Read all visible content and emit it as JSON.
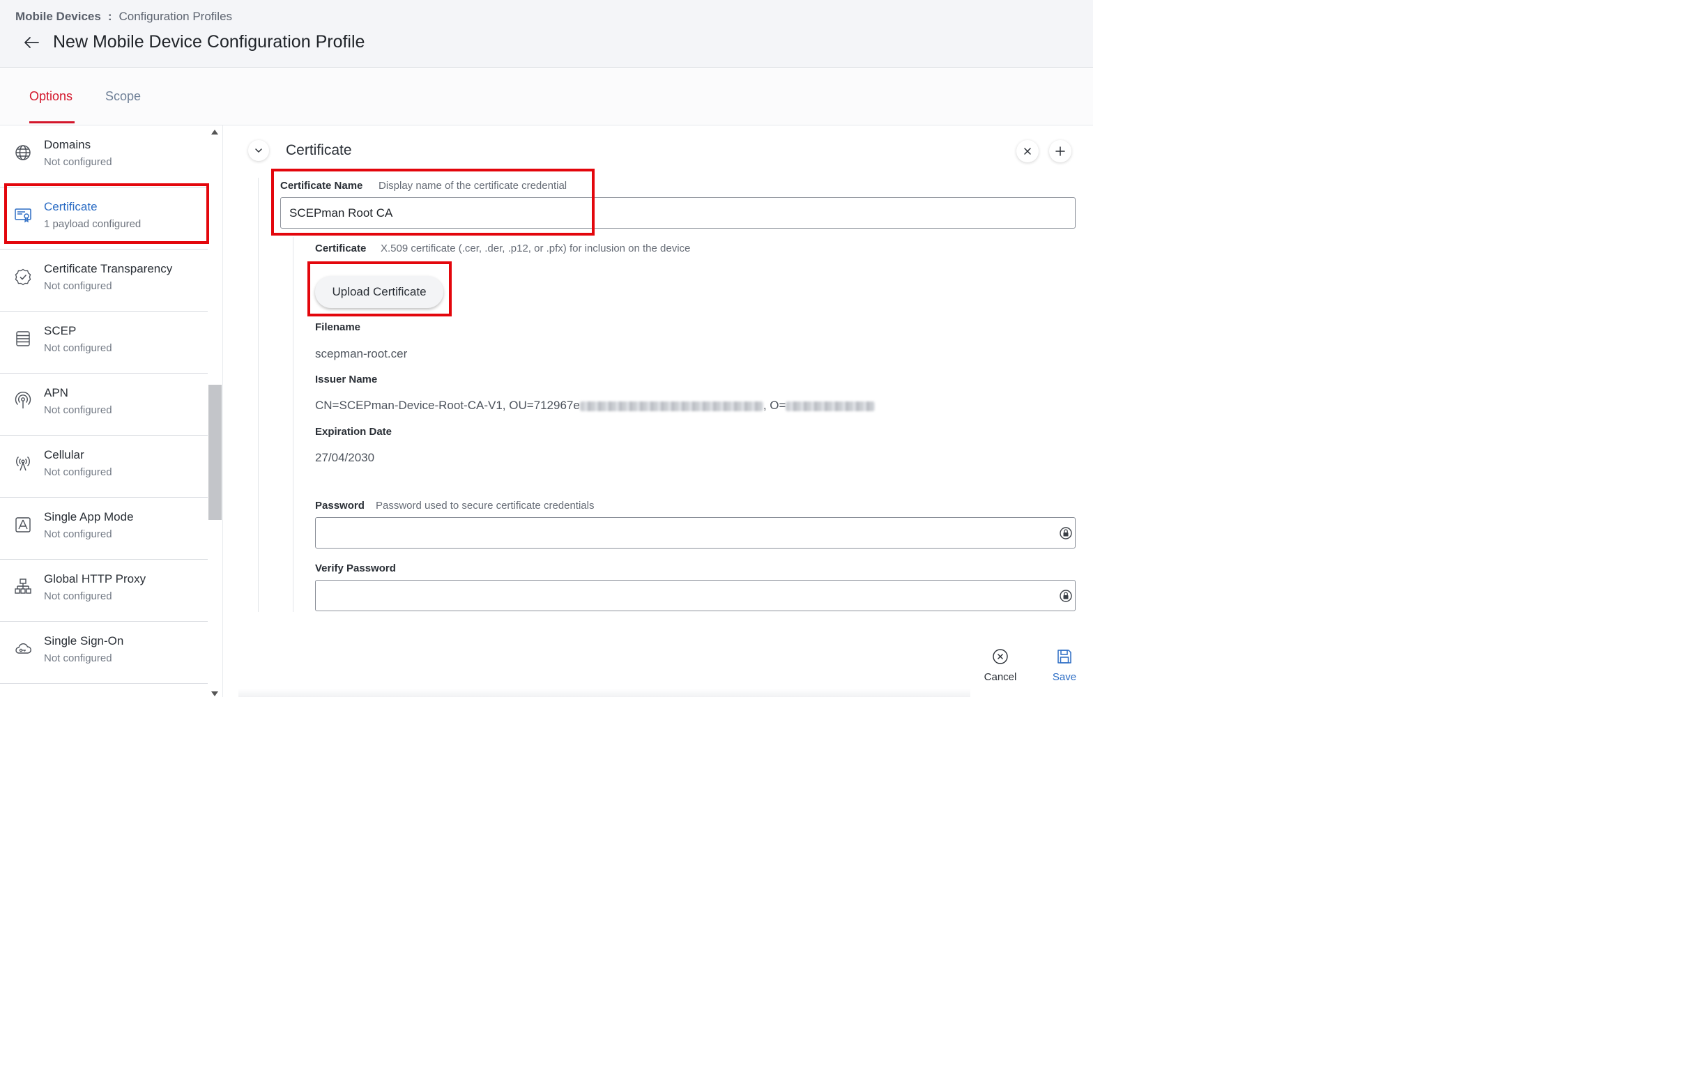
{
  "header": {
    "breadcrumb": {
      "root": "Mobile Devices",
      "separator": ":",
      "current": "Configuration Profiles"
    },
    "title": "New Mobile Device Configuration Profile",
    "back_icon": "arrow-left-icon"
  },
  "tabs": [
    {
      "label": "Options",
      "active": true
    },
    {
      "label": "Scope",
      "active": false
    }
  ],
  "sidebar": {
    "items": [
      {
        "label": "Domains",
        "status": "Not configured",
        "icon": "globe-icon"
      },
      {
        "label": "Certificate",
        "status": "1 payload configured",
        "icon": "certificate-icon",
        "active": true
      },
      {
        "label": "Certificate Transparency",
        "status": "Not configured",
        "icon": "badge-check-icon"
      },
      {
        "label": "SCEP",
        "status": "Not configured",
        "icon": "server-list-icon"
      },
      {
        "label": "APN",
        "status": "Not configured",
        "icon": "antenna-icon"
      },
      {
        "label": "Cellular",
        "status": "Not configured",
        "icon": "cellular-signal-icon"
      },
      {
        "label": "Single App Mode",
        "status": "Not configured",
        "icon": "app-store-icon"
      },
      {
        "label": "Global HTTP Proxy",
        "status": "Not configured",
        "icon": "network-tree-icon"
      },
      {
        "label": "Single Sign-On",
        "status": "Not configured",
        "icon": "cloud-key-icon"
      }
    ]
  },
  "main": {
    "section_title": "Certificate",
    "certificate_name": {
      "label": "Certificate Name",
      "hint": "Display name of the certificate credential",
      "value": "SCEPman Root CA"
    },
    "certificate": {
      "label": "Certificate",
      "hint": "X.509 certificate (.cer, .der, .p12, or .pfx) for inclusion on the device",
      "upload_label": "Upload Certificate"
    },
    "filename": {
      "label": "Filename",
      "value": "scepman-root.cer"
    },
    "issuer_name": {
      "label": "Issuer Name",
      "value_prefix": "CN=SCEPman-Device-Root-CA-V1, OU=712967e",
      "value_middle": ", O="
    },
    "expiration_date": {
      "label": "Expiration Date",
      "value": "27/04/2030"
    },
    "password": {
      "label": "Password",
      "hint": "Password used to secure certificate credentials",
      "value": ""
    },
    "verify_password": {
      "label": "Verify Password",
      "value": ""
    }
  },
  "footer": {
    "cancel_label": "Cancel",
    "save_label": "Save"
  },
  "colors": {
    "accent_red": "#d3162b",
    "highlight_red": "#e3060c",
    "link_blue": "#2b6cc4"
  }
}
